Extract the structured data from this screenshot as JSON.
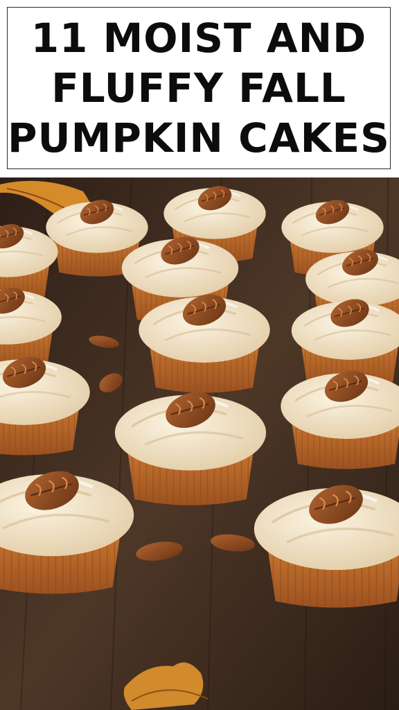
{
  "title": "11 MOIST AND\nFLUFFY FALL\nPUMPKIN CAKES",
  "colors": {
    "background": "#ffffff",
    "title_text": "#0c0c0c",
    "table_wood": "#4a3426",
    "cake": "#c0722d",
    "frosting": "#f3e7cf",
    "pecan": "#8b4a20"
  }
}
